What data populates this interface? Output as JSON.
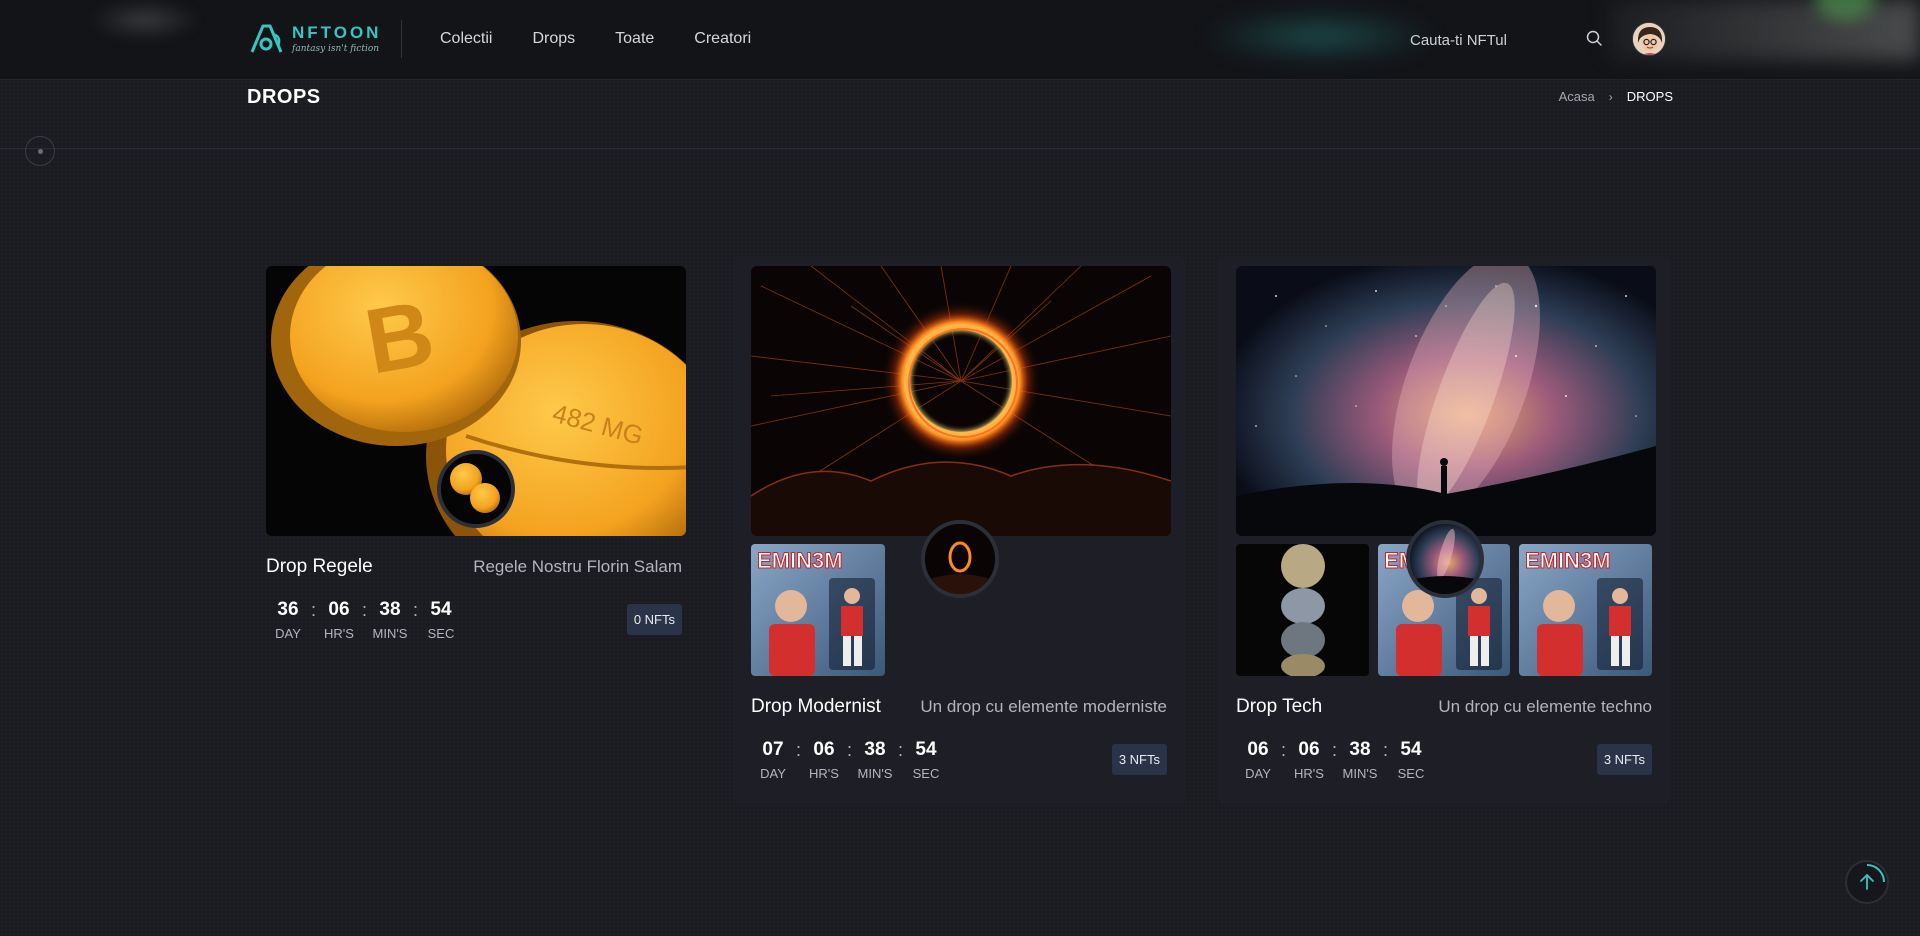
{
  "brand": {
    "name": "NFTOON",
    "tagline": "fantasy isn't fiction"
  },
  "nav": {
    "items": [
      "Colectii",
      "Drops",
      "Toate",
      "Creatori"
    ]
  },
  "search": {
    "placeholder": "Cauta-ti NFTul",
    "icon": "search-icon"
  },
  "user": {
    "avatar": "user-avatar"
  },
  "page": {
    "title": "DROPS",
    "breadcrumb": {
      "home": "Acasa",
      "current": "DROPS",
      "separator": "›"
    }
  },
  "colors": {
    "accent": "#35c6c0",
    "badge": "#2a3347",
    "background": "#1b1c22"
  },
  "drops": [
    {
      "name": "Drop Regele",
      "description": "Regele Nostru Florin Salam",
      "countdown": {
        "days": "36",
        "hours": "06",
        "mins": "38",
        "secs": "54"
      },
      "nfts": "0 NFTs"
    },
    {
      "name": "Drop Modernist",
      "description": "Un drop cu elemente moderniste",
      "countdown": {
        "days": "07",
        "hours": "06",
        "mins": "38",
        "secs": "54"
      },
      "nfts": "3 NFTs"
    },
    {
      "name": "Drop Tech",
      "description": "Un drop cu elemente techno",
      "countdown": {
        "days": "06",
        "hours": "06",
        "mins": "38",
        "secs": "54"
      },
      "nfts": "3 NFTs"
    }
  ],
  "countdown_labels": {
    "days": "DAY",
    "hours": "HR'S",
    "mins": "MIN'S",
    "secs": "SEC",
    "separator": ":"
  },
  "thumb_text": "EMIN3M"
}
